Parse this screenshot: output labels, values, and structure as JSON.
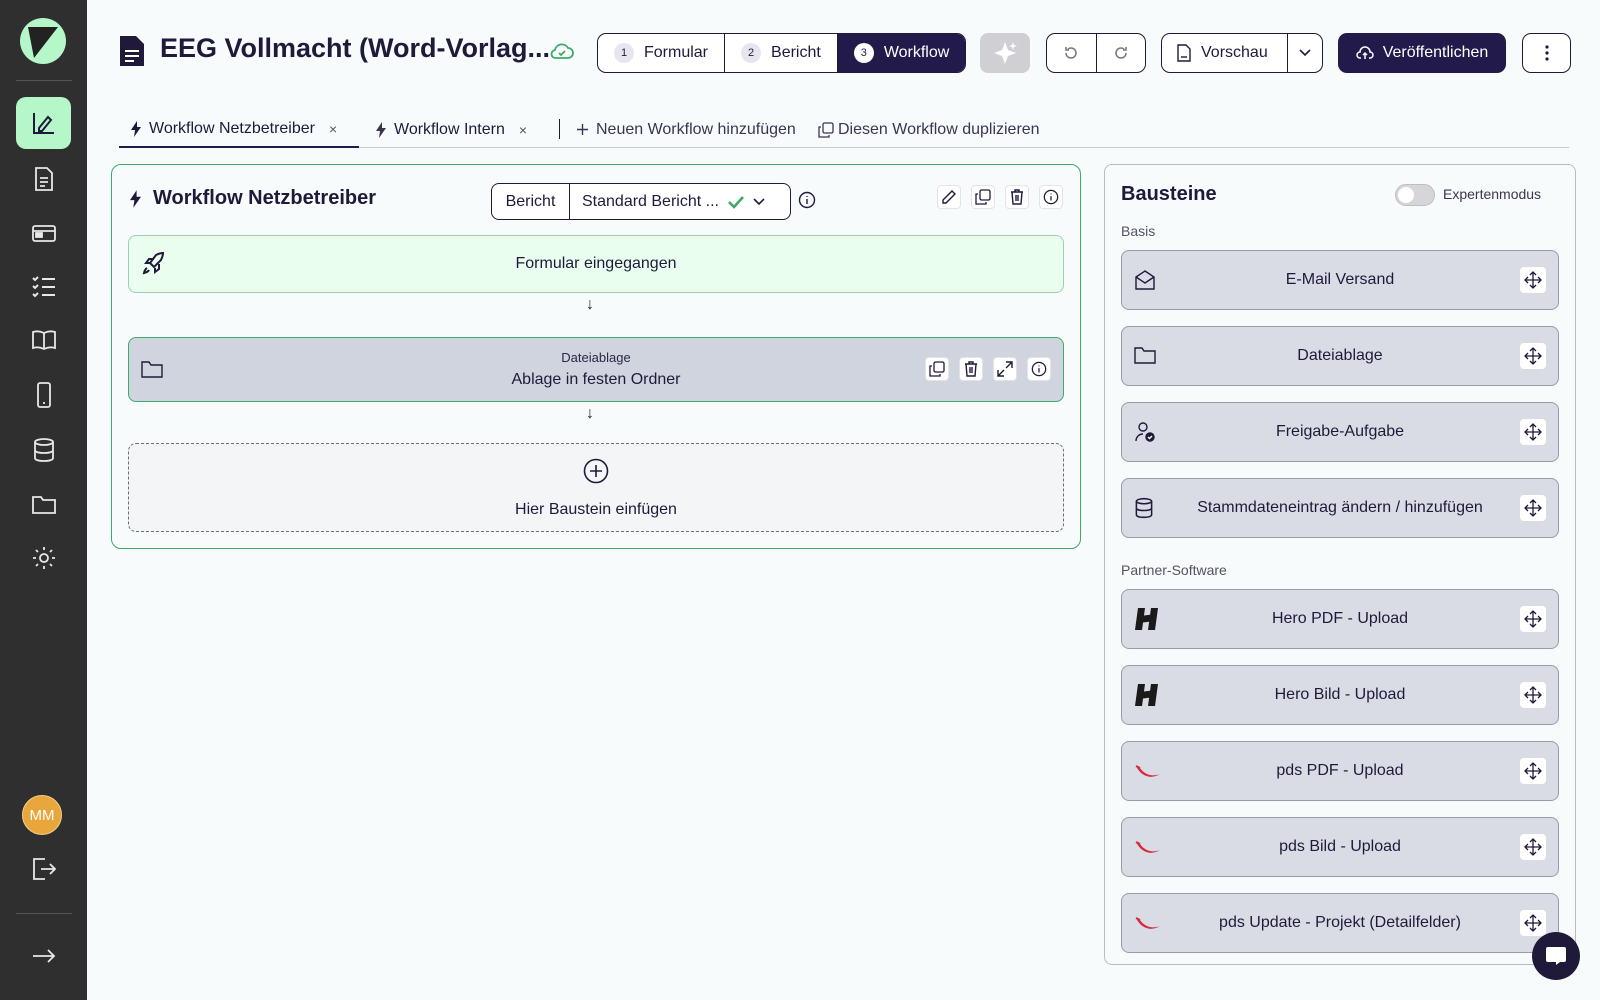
{
  "document": {
    "title": "EEG Vollmacht (Word-Vorlag..."
  },
  "steps": [
    {
      "num": "1",
      "label": "Formular",
      "active": false
    },
    {
      "num": "2",
      "label": "Bericht",
      "active": false
    },
    {
      "num": "3",
      "label": "Workflow",
      "active": true
    }
  ],
  "toolbar": {
    "preview_label": "Vorschau",
    "publish_label": "Veröffentlichen"
  },
  "user": {
    "initials": "MM"
  },
  "workflow_tabs": {
    "tab1": "Workflow Netzbetreiber",
    "tab2": "Workflow Intern",
    "close": "×",
    "add": "Neuen Workflow hinzufügen",
    "duplicate": "Diesen Workflow duplizieren"
  },
  "workflow": {
    "title": "Workflow Netzbetreiber",
    "report_label": "Bericht",
    "report_value": "Standard Bericht ...",
    "start_node": "Formular eingegangen",
    "arrow": "↓",
    "step_type": "Dateiablage",
    "step_title": "Ablage in festen Ordner",
    "add_node": "Hier Baustein einfügen"
  },
  "bausteine": {
    "title": "Bausteine",
    "expert_mode_label": "Expertenmodus",
    "basis_label": "Basis",
    "partner_label": "Partner-Software",
    "basis": [
      {
        "label": "E-Mail Versand",
        "icon": "email-icon"
      },
      {
        "label": "Dateiablage",
        "icon": "folder-icon"
      },
      {
        "label": "Freigabe-Aufgabe",
        "icon": "user-check-icon"
      },
      {
        "label": "Stammdateneintrag ändern / hinzufügen",
        "icon": "database-icon"
      }
    ],
    "partner": [
      {
        "label": "Hero PDF - Upload",
        "icon": "hero-logo-icon"
      },
      {
        "label": "Hero Bild - Upload",
        "icon": "hero-logo-icon"
      },
      {
        "label": "pds PDF - Upload",
        "icon": "pds-logo-icon"
      },
      {
        "label": "pds Bild - Upload",
        "icon": "pds-logo-icon"
      },
      {
        "label": "pds Update - Projekt (Detailfelder)",
        "icon": "pds-logo-icon"
      }
    ]
  },
  "colors": {
    "sidebar_bg": "#2f2f2f",
    "accent_mint": "#b5f7c9",
    "primary_dark": "#221a4a",
    "success_green": "#3fa96a"
  }
}
